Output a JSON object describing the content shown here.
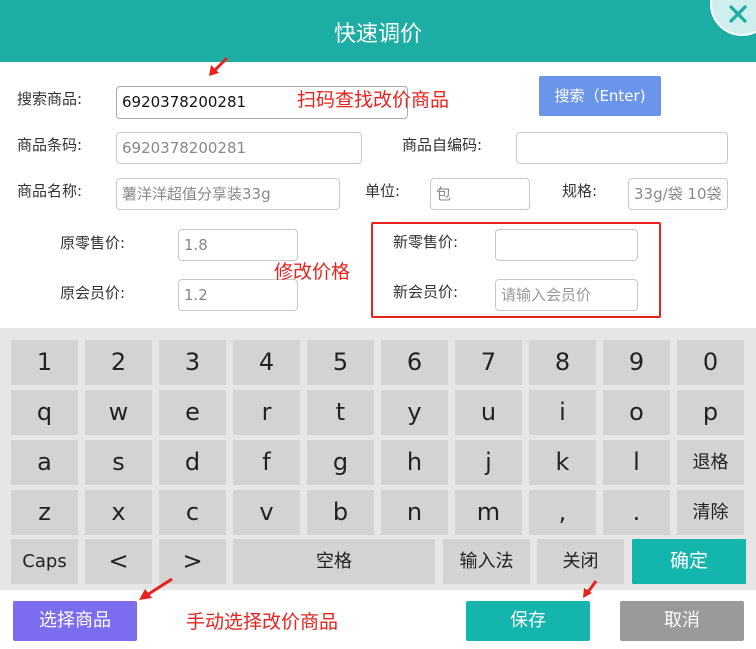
{
  "header": {
    "title": "快速调价"
  },
  "form": {
    "search_label": "搜索商品:",
    "search_value": "6920378200281",
    "search_button": "搜索（Enter)",
    "barcode_label": "商品条码:",
    "barcode_value": "6920378200281",
    "self_code_label": "商品自编码:",
    "self_code_value": "",
    "name_label": "商品名称:",
    "name_value": "薯洋洋超值分享装33g",
    "unit_label": "单位:",
    "unit_value": "包",
    "spec_label": "规格:",
    "spec_value": "33g/袋 10袋",
    "old_retail_label": "原零售价:",
    "old_retail_value": "1.8",
    "old_member_label": "原会员价:",
    "old_member_value": "1.2",
    "new_retail_label": "新零售价:",
    "new_retail_value": "",
    "new_member_label": "新会员价:",
    "new_member_placeholder": "请输入会员价"
  },
  "annotations": {
    "scan": "扫码查找改价商品",
    "modify": "修改价格",
    "manual": "手动选择改价商品"
  },
  "keyboard": {
    "row1": [
      "1",
      "2",
      "3",
      "4",
      "5",
      "6",
      "7",
      "8",
      "9",
      "0"
    ],
    "row2": [
      "q",
      "w",
      "e",
      "r",
      "t",
      "y",
      "u",
      "i",
      "o",
      "p"
    ],
    "row3": [
      "a",
      "s",
      "d",
      "f",
      "g",
      "h",
      "j",
      "k",
      "l",
      "退格"
    ],
    "row4": [
      "z",
      "x",
      "c",
      "v",
      "b",
      "n",
      "m",
      ",",
      ".",
      "清除"
    ],
    "caps": "Caps",
    "lt": "<",
    "gt": ">",
    "space": "空格",
    "ime": "输入法",
    "close": "关闭",
    "confirm": "确定"
  },
  "bottom": {
    "select_product": "选择商品",
    "save": "保存",
    "cancel": "取消"
  },
  "colors": {
    "header": "#1cada4",
    "teal_button": "#13b5ac",
    "search_button": "#6b95ea",
    "select_button": "#7b6cf0",
    "cancel_button": "#9a9a9a",
    "annotation_red": "#e8231e"
  }
}
